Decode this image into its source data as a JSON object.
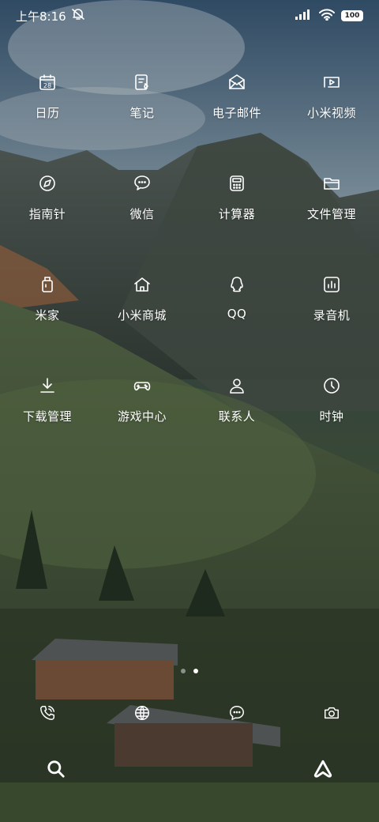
{
  "status_bar": {
    "time": "上午8:16",
    "battery": "100"
  },
  "apps": [
    {
      "label": "日历",
      "icon": "calendar-icon",
      "calendar_day": "28"
    },
    {
      "label": "笔记",
      "icon": "notes-icon"
    },
    {
      "label": "电子邮件",
      "icon": "email-icon"
    },
    {
      "label": "小米视频",
      "icon": "video-icon"
    },
    {
      "label": "指南针",
      "icon": "compass-icon"
    },
    {
      "label": "微信",
      "icon": "wechat-icon"
    },
    {
      "label": "计算器",
      "icon": "calculator-icon"
    },
    {
      "label": "文件管理",
      "icon": "folder-icon"
    },
    {
      "label": "米家",
      "icon": "mijia-icon"
    },
    {
      "label": "小米商城",
      "icon": "store-icon"
    },
    {
      "label": "QQ",
      "icon": "qq-icon"
    },
    {
      "label": "录音机",
      "icon": "recorder-icon"
    },
    {
      "label": "下载管理",
      "icon": "download-icon"
    },
    {
      "label": "游戏中心",
      "icon": "gamepad-icon"
    },
    {
      "label": "联系人",
      "icon": "contacts-icon"
    },
    {
      "label": "时钟",
      "icon": "clock-icon"
    }
  ],
  "page_indicator": {
    "pages": 2,
    "current": 2
  },
  "dock": [
    {
      "icon": "phone-icon"
    },
    {
      "icon": "browser-icon"
    },
    {
      "icon": "messages-icon"
    },
    {
      "icon": "camera-icon"
    }
  ],
  "bottom_bar": [
    {
      "icon": "search-icon"
    },
    {
      "icon": "assistant-icon"
    }
  ]
}
